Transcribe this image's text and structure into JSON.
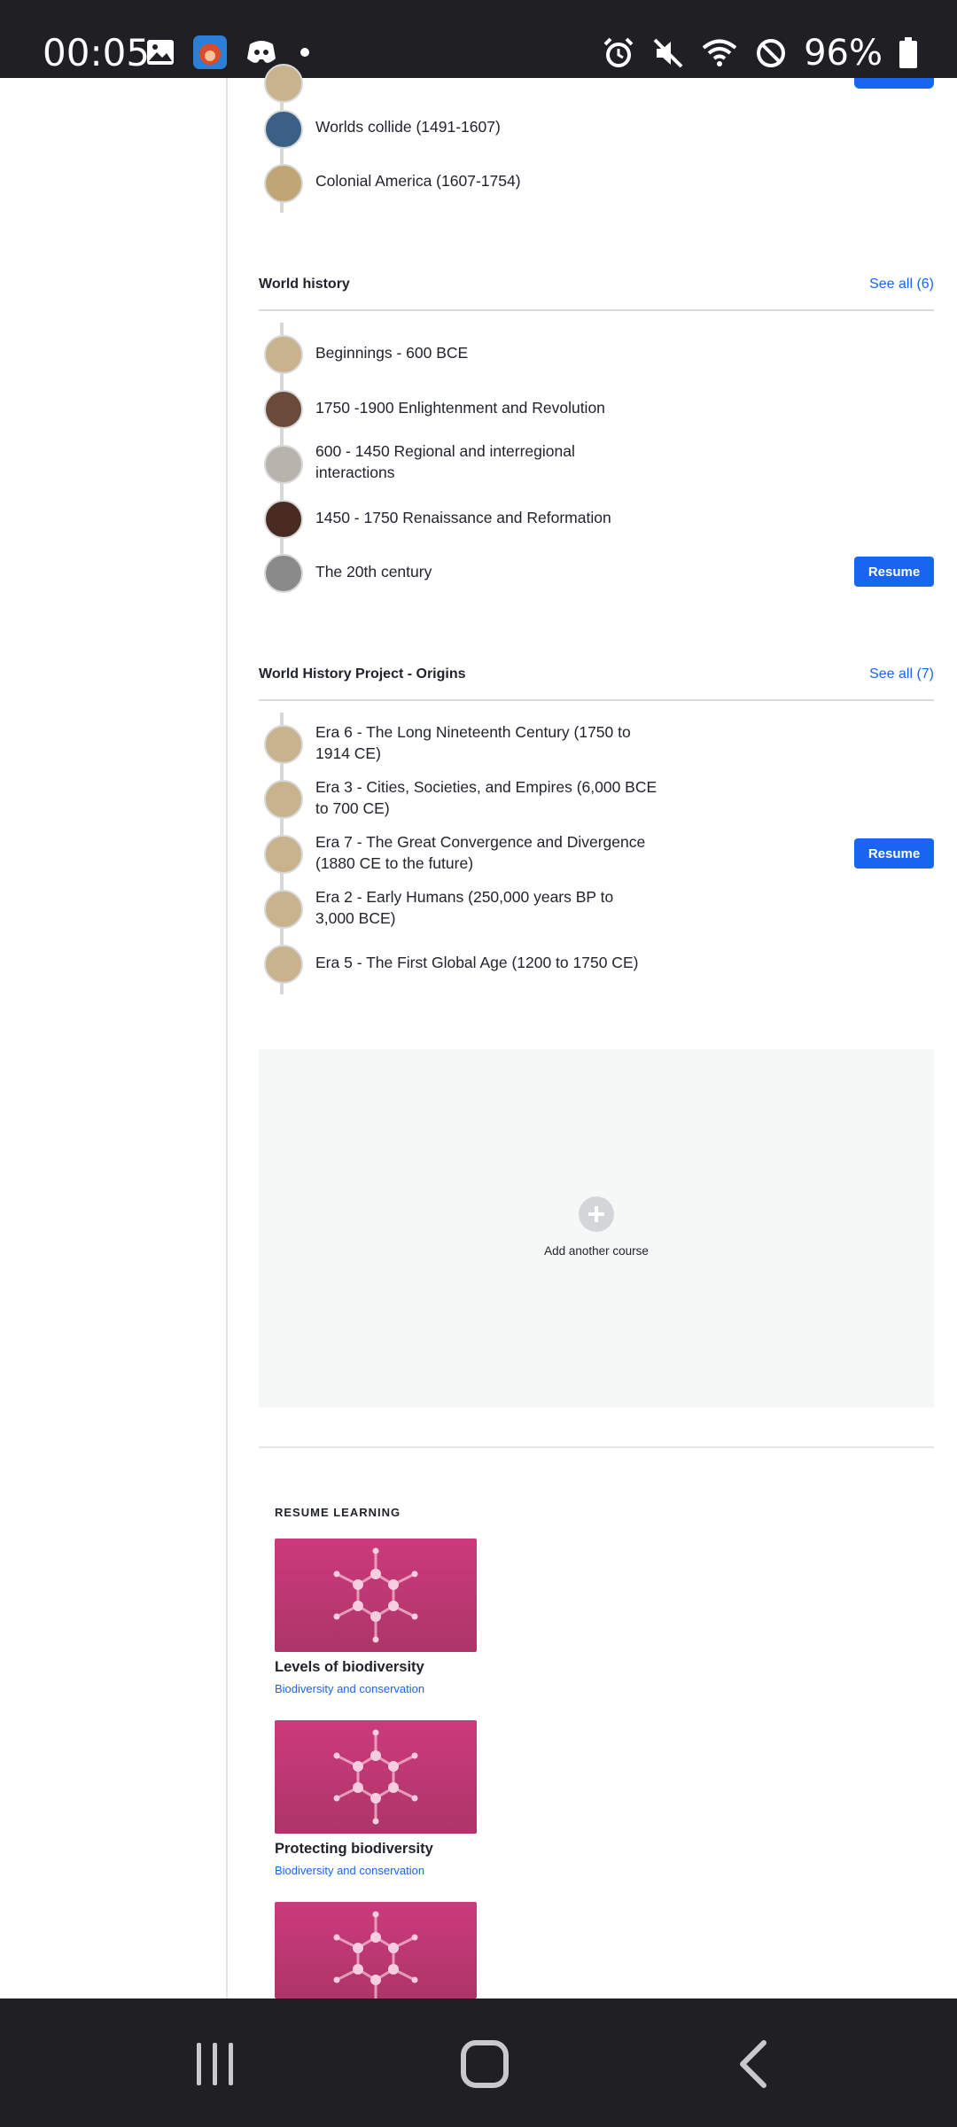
{
  "status_bar": {
    "time": "00:05",
    "battery_percent": "96%",
    "icons": [
      "image-icon",
      "app-icon",
      "discord-icon",
      "dot-icon",
      "alarm-icon",
      "mute-icon",
      "wifi-icon",
      "do-not-disturb-icon",
      "battery-icon"
    ]
  },
  "us_history": {
    "units": [
      {
        "title": "Worlds collide (1491-1607)"
      },
      {
        "title": "Colonial America (1607-1754)"
      }
    ]
  },
  "world_history": {
    "title": "World history",
    "see_all": "See all (6)",
    "units": [
      {
        "title": "Beginnings - 600 BCE"
      },
      {
        "title": "1750 -1900 Enlightenment and Revolution"
      },
      {
        "title_line1": "600 - 1450 Regional and interregional",
        "title_line2": "interactions"
      },
      {
        "title": "1450 - 1750 Renaissance and Reformation"
      },
      {
        "title": "The 20th century"
      }
    ],
    "resume_label": "Resume"
  },
  "world_history_project": {
    "title": "World History Project - Origins",
    "see_all": "See all (7)",
    "units": [
      {
        "title_line1": "Era 6 - The Long Nineteenth Century (1750 to",
        "title_line2": "1914 CE)"
      },
      {
        "title_line1": "Era 3 - Cities, Societies, and Empires (6,000 BCE",
        "title_line2": "to 700 CE)"
      },
      {
        "title_line1": "Era 7 - The Great Convergence and Divergence",
        "title_line2": "(1880 CE to the future)"
      },
      {
        "title_line1": "Era 2 - Early Humans (250,000 years BP to",
        "title_line2": "3,000 BCE)"
      },
      {
        "title": "Era 5 - The First Global Age (1200 to 1750 CE)"
      }
    ],
    "resume_label": "Resume"
  },
  "add_course": {
    "label": "Add another course"
  },
  "resume_learning": {
    "heading": "RESUME LEARNING",
    "cards": [
      {
        "title": "Levels of biodiversity",
        "subtitle": "Biodiversity and conservation"
      },
      {
        "title": "Protecting biodiversity",
        "subtitle": "Biodiversity and conservation"
      }
    ]
  },
  "colors": {
    "accent": "#1865f2",
    "card": "#c13774",
    "status_bar": "#1f1f24"
  }
}
